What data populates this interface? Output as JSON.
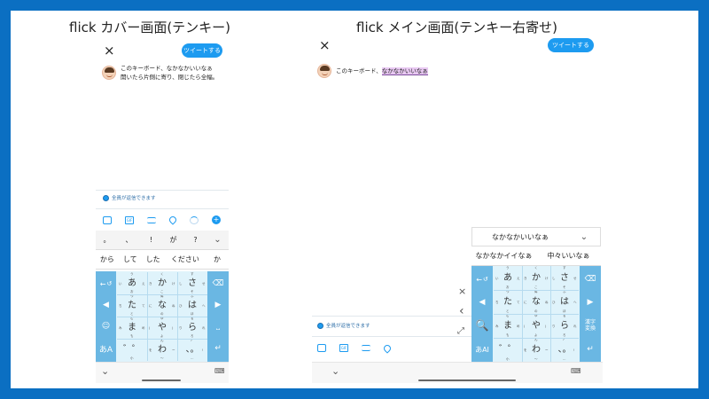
{
  "titles": {
    "left": "flick カバー画面(テンキー)",
    "right": "flick メイン画面(テンキー右寄せ)"
  },
  "left": {
    "close": "×",
    "tweet_button": "ツイートする",
    "tweet_line1": "このキーボード、なかなかいいなぁ",
    "tweet_line2": "開いたら片側に寄り、閉じたら全幅。",
    "reply_setting": "全員が返信できます",
    "tools": [
      "image-icon",
      "gif-icon",
      "list-icon",
      "location-icon",
      "progress-icon",
      "plus-icon"
    ],
    "gif_label": "GIF",
    "plus_label": "+",
    "punct_row": [
      "。",
      "、",
      "!",
      "が",
      "?"
    ],
    "pred_row": [
      "から",
      "して",
      "した",
      "ください",
      "か"
    ],
    "chevron": "⌄"
  },
  "right": {
    "close": "×",
    "tweet_button": "ツイートする",
    "tweet_prefix": "このキーボード、",
    "tweet_highlight": "なかなかいいなぁ",
    "reply_setting": "全員が返信できます",
    "tools": [
      "image-icon",
      "gif-icon",
      "list-icon",
      "location-icon"
    ],
    "gif_label": "GIF",
    "cand_top": "なかなかいいなぁ",
    "cand_row2": [
      "なかなかイイなぁ",
      "中々いいなぁ"
    ],
    "side_icons": [
      "×",
      "‹",
      "⤢"
    ],
    "chevron": "⌄",
    "kanji_key": "漢字\n変換"
  },
  "keyboard": {
    "left_keys": [
      "←",
      "◀",
      "☺",
      "あA"
    ],
    "right_keys": [
      "⌫",
      "▶",
      "⎵",
      "↵"
    ],
    "left_undo": "↺",
    "grid": [
      [
        {
          "m": "あ",
          "t": "う",
          "l": "い",
          "r": "え",
          "b": "お"
        },
        {
          "m": "か",
          "t": "く",
          "l": "き",
          "r": "け",
          "b": "こ"
        },
        {
          "m": "さ",
          "t": "す",
          "l": "し",
          "r": "せ",
          "b": "そ"
        }
      ],
      [
        {
          "m": "た",
          "t": "つ",
          "l": "ち",
          "r": "て",
          "b": "と"
        },
        {
          "m": "な",
          "t": "ぬ",
          "l": "に",
          "r": "ね",
          "b": "の"
        },
        {
          "m": "は",
          "t": "ふ",
          "l": "ひ",
          "r": "へ",
          "b": "ほ"
        }
      ],
      [
        {
          "m": "ま",
          "t": "む",
          "l": "み",
          "r": "め",
          "b": "も"
        },
        {
          "m": "や",
          "t": "ゆ",
          "l": "(",
          "r": ")",
          "b": "よ"
        },
        {
          "m": "ら",
          "t": "る",
          "l": "り",
          "r": "れ",
          "b": "ろ"
        }
      ],
      [
        {
          "m": "゛゜",
          "t": "",
          "l": "",
          "r": "",
          "b": "小"
        },
        {
          "m": "わ",
          "t": "ん",
          "l": "を",
          "r": "ー",
          "b": "〜"
        },
        {
          "m": "、。",
          "t": "?",
          "l": "",
          "r": "!",
          "b": "…"
        }
      ]
    ],
    "search": "🔍",
    "ai_label": "あAI"
  },
  "bottom": {
    "down_chevron": "⌄",
    "keyboard_icon": "⌨"
  }
}
